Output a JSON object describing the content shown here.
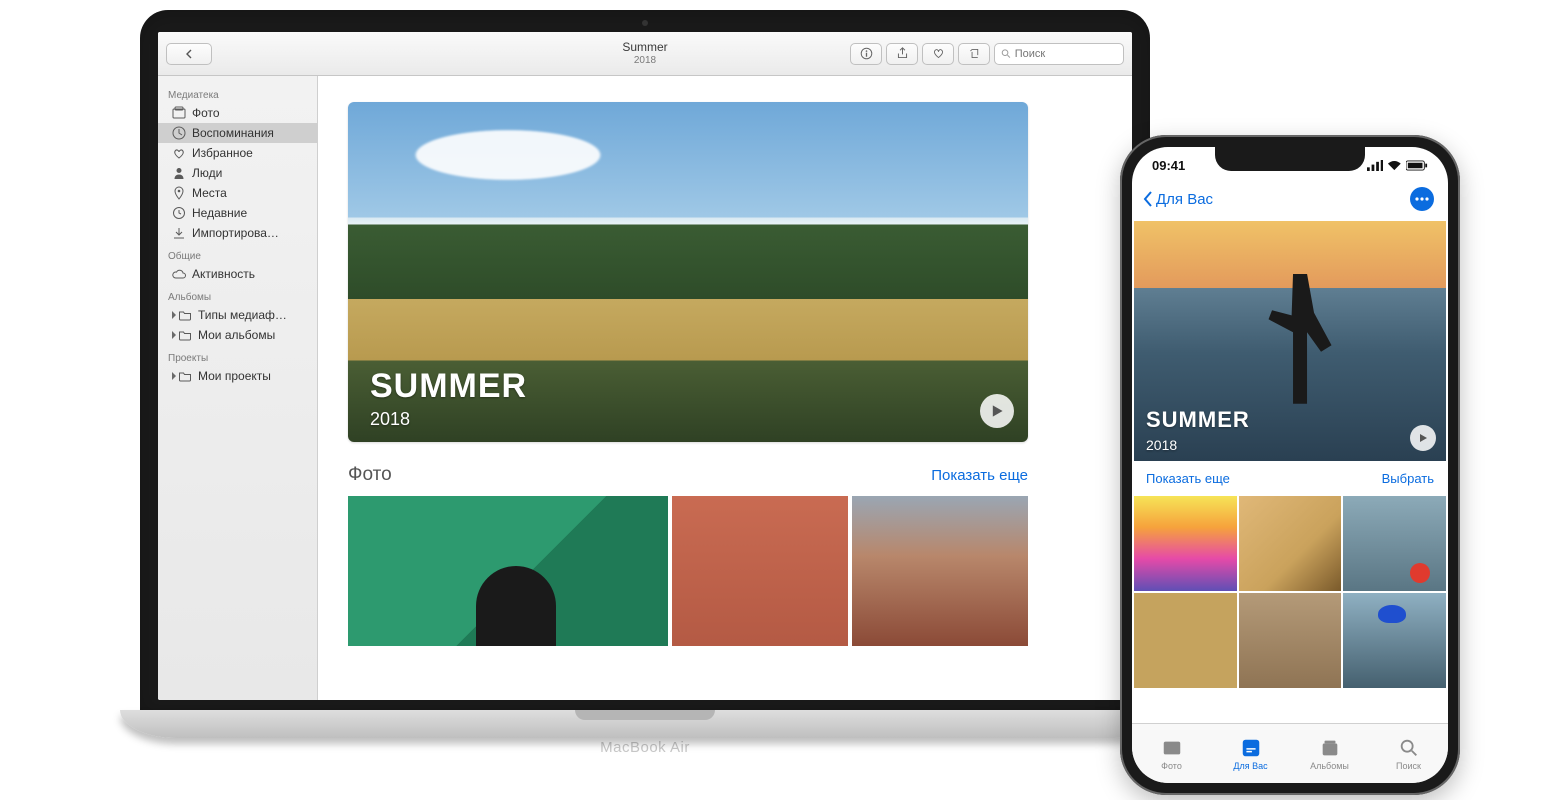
{
  "mac": {
    "device_label": "MacBook Air",
    "titlebar": {
      "title": "Summer",
      "subtitle": "2018",
      "search_placeholder": "Поиск"
    },
    "sidebar": {
      "sections": [
        {
          "heading": "Медиатека",
          "items": [
            {
              "label": "Фото"
            },
            {
              "label": "Воспоминания"
            },
            {
              "label": "Избранное"
            },
            {
              "label": "Люди"
            },
            {
              "label": "Места"
            },
            {
              "label": "Недавние"
            },
            {
              "label": "Импортирова…"
            }
          ]
        },
        {
          "heading": "Общие",
          "items": [
            {
              "label": "Активность"
            }
          ]
        },
        {
          "heading": "Альбомы",
          "items": [
            {
              "label": "Типы медиаф…"
            },
            {
              "label": "Мои альбомы"
            }
          ]
        },
        {
          "heading": "Проекты",
          "items": [
            {
              "label": "Мои проекты"
            }
          ]
        }
      ]
    },
    "hero": {
      "title": "SUMMER",
      "year": "2018"
    },
    "section": {
      "heading": "Фото",
      "show_more": "Показать еще"
    }
  },
  "iphone": {
    "status": {
      "time": "09:41"
    },
    "nav": {
      "back_label": "Для Вас"
    },
    "hero": {
      "title": "SUMMER",
      "year": "2018"
    },
    "actions": {
      "show_more": "Показать еще",
      "select": "Выбрать"
    },
    "tabs": [
      {
        "label": "Фото"
      },
      {
        "label": "Для Вас"
      },
      {
        "label": "Альбомы"
      },
      {
        "label": "Поиск"
      }
    ]
  }
}
